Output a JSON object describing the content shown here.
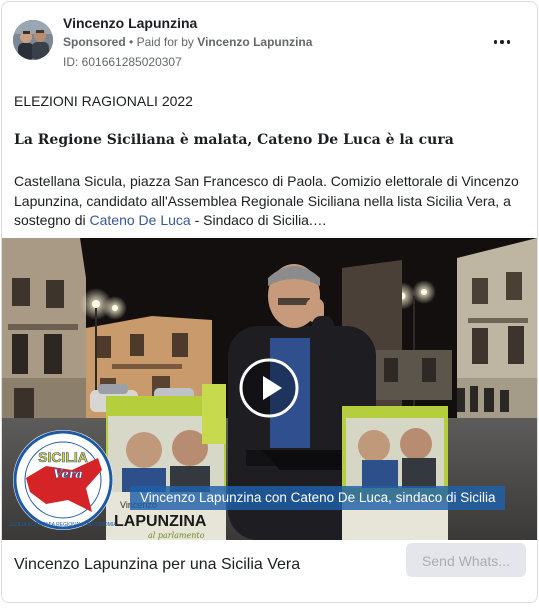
{
  "post": {
    "page_name": "Vincenzo Lapunzina",
    "sponsored_label": "Sponsored",
    "bullet": "•",
    "paid_for_prefix": "Paid for by",
    "paid_for_name": "Vincenzo Lapunzina",
    "ad_id": "ID: 601661285020307",
    "more_icon": "more-horizontal-icon"
  },
  "content": {
    "elezioni": "ELEZIONI RAGIONALI 2022",
    "headline": "La Regione Siciliana è malata, Cateno De Luca è la cura",
    "body_part1": "Castellana Sicula, piazza San Francesco di Paola. Comizio elettorale di Vincenzo Lapunzina, candidato all'Assemblea Regionale Siciliana nella lista Sicilia Vera, a sostegno di ",
    "body_link": "Cateno De Luca",
    "body_part2": " - Sindaco di Sicilia.…"
  },
  "media": {
    "caption": "Vincenzo Lapunzina con Cateno De Luca, sindaco di Sicilia",
    "logo_text_main": "SICILIA",
    "logo_text_sub": "Vera",
    "logo_ring_text": "SICILIA ECONOMIA REGIONALE AUTONOMIA",
    "poster_name_small": "Vincenzo",
    "poster_name_big": "LAPUNZINA",
    "poster_sub": "al parlamento",
    "play_icon": "play-icon"
  },
  "footer": {
    "title": "Vincenzo Lapunzina per una Sicilia Vera",
    "cta": "Send Whats..."
  },
  "colors": {
    "text": "#1c1e21",
    "secondary": "#65676b",
    "link": "#385898",
    "caption_bg": "#1e60aa",
    "cta_bg": "#e4e6eb",
    "cta_text": "#a9acb1",
    "logo_red": "#d42428",
    "logo_blue": "#1c5aa6",
    "poster_green": "#b5cf3c"
  }
}
